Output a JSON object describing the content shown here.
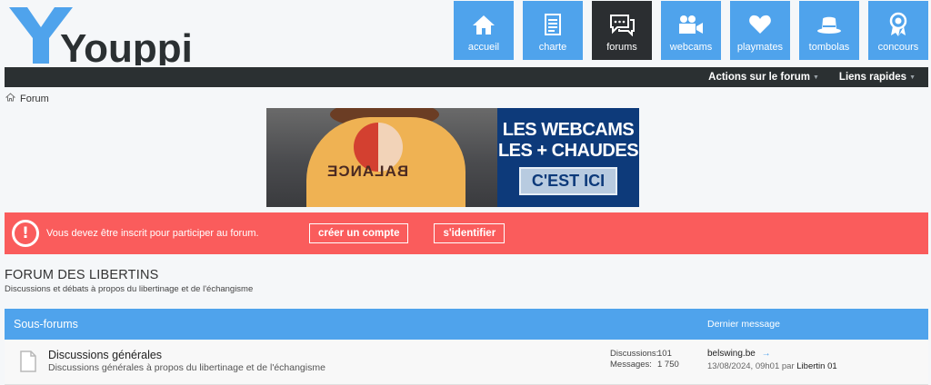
{
  "logo": {
    "text": "Youppie"
  },
  "nav": [
    {
      "label": "accueil",
      "icon": "home-icon"
    },
    {
      "label": "charte",
      "icon": "document-icon"
    },
    {
      "label": "forums",
      "icon": "chat-icon",
      "active": true
    },
    {
      "label": "webcams",
      "icon": "camera-icon"
    },
    {
      "label": "playmates",
      "icon": "heart-icon"
    },
    {
      "label": "tombolas",
      "icon": "hat-icon"
    },
    {
      "label": "concours",
      "icon": "award-icon"
    }
  ],
  "topbar": {
    "actions": "Actions sur le forum",
    "quick_links": "Liens rapides"
  },
  "breadcrumb": {
    "label": "Forum"
  },
  "banner": {
    "line1": "LES WEBCAMS",
    "line2": "LES + CHAUDES",
    "cta": "C'EST ICI",
    "shirt_text": "BALANCE"
  },
  "alert": {
    "message": "Vous devez être inscrit pour participer au forum.",
    "create_account": "créer un compte",
    "login": "s'identifier"
  },
  "forum": {
    "title": "FORUM DES LIBERTINS",
    "description": "Discussions et débats à propos du libertinage et de l'échangisme"
  },
  "table": {
    "col_subforums": "Sous-forums",
    "col_last_message": "Dernier message",
    "rows": [
      {
        "name": "Discussions générales",
        "description": "Discussions générales à propos du libertinage et de l'échangisme",
        "discussions_label": "Discussions:",
        "discussions_value": "101",
        "messages_label": "Messages:",
        "messages_value": "1 750",
        "last_title": "belswing.be",
        "last_date": "13/08/2024, 09h01",
        "last_by": "par",
        "last_user": "Libertin 01"
      }
    ]
  },
  "colors": {
    "nav_blue": "#4fa3ec",
    "nav_active": "#2b2e31",
    "alert_red": "#fa5c5c",
    "banner_navy": "#0d3a7a"
  }
}
